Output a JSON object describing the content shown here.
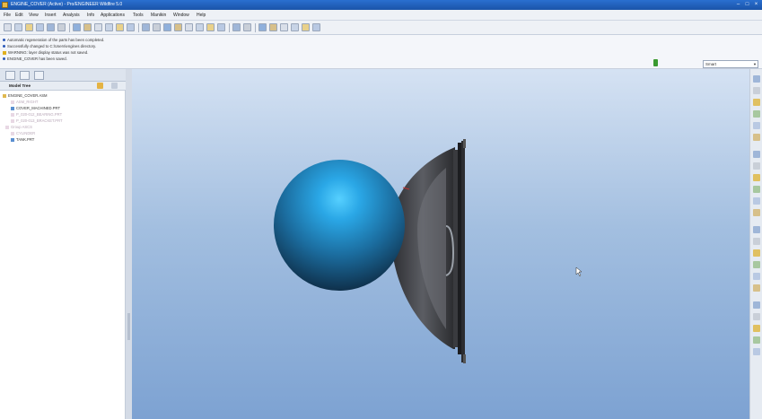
{
  "window": {
    "title": "ENGINE_COVER (Active) - Pro/ENGINEER Wildfire 5.0",
    "controls": [
      "–",
      "□",
      "×"
    ]
  },
  "menu": [
    "File",
    "Edit",
    "View",
    "Insert",
    "Analysis",
    "Info",
    "Applications",
    "Tools",
    "Manikin",
    "Window",
    "Help"
  ],
  "messages": [
    {
      "type": "info",
      "text": "Automatic regeneration of the parts has been completed."
    },
    {
      "type": "info",
      "text": "Successfully changed to C:\\Users\\engines directory."
    },
    {
      "type": "warning",
      "text": "WARNING: layer display status was not saved."
    },
    {
      "type": "info",
      "text": "ENGINE_COVER has been saved."
    }
  ],
  "filter": {
    "selected": "Smart"
  },
  "model_tree": {
    "title": "Model Tree",
    "items": [
      {
        "label": "ENGINE_COVER.ASM",
        "dim": false,
        "level": 0
      },
      {
        "label": "ASM_RIGHT",
        "dim": true,
        "level": 1
      },
      {
        "label": "COVER_MACHINED.PRT",
        "dim": false,
        "level": 1
      },
      {
        "label": "P_020-012_BEARING.PRT",
        "dim": true,
        "level": 1
      },
      {
        "label": "P_020-013_BRACKET.PRT",
        "dim": true,
        "level": 1
      },
      {
        "label": "Group ASCS",
        "dim": true,
        "level": 1
      },
      {
        "label": "CYLINDER",
        "dim": true,
        "level": 1
      },
      {
        "label": "TANK.PRT",
        "dim": false,
        "level": 1
      }
    ]
  },
  "icons": {
    "toolbar": [
      "new-icon",
      "open-icon",
      "save-icon",
      "print-icon",
      "email-icon",
      "copy-icon",
      "undo-icon",
      "redo-icon",
      "cut-icon",
      "paste-icon",
      "regenerate-icon",
      "find-icon",
      "select-box-icon",
      "repaint-icon",
      "orient-icon",
      "spin-center-icon",
      "zoom-in-icon",
      "zoom-out-icon",
      "refit-icon",
      "named-view-icon",
      "layers-icon",
      "display-style-icon",
      "datum-plane-icon",
      "datum-axis-icon",
      "datum-point-icon",
      "csys-icon",
      "annotation-icon",
      "whats-this-icon"
    ],
    "right": [
      "datum-plane-icon",
      "datum-axis-icon",
      "sketch-curve-icon",
      "datum-point-icon",
      "csys-icon",
      "analysis-icon",
      "extrude-icon",
      "revolve-icon",
      "sweep-icon",
      "hole-icon",
      "round-icon",
      "chamfer-icon",
      "rib-icon",
      "draft-icon",
      "shell-icon",
      "pattern-icon",
      "mirror-icon",
      "merge-icon",
      "trim-icon",
      "offset-icon",
      "thicken-icon",
      "solidify-icon",
      "style-icon"
    ]
  },
  "colors": {
    "sphere": "#2aa7e6",
    "cover": "#2e2f33",
    "titlebar": "#1b54a8",
    "background_top": "#d5e2f3",
    "background_bottom": "#7da2d2"
  }
}
